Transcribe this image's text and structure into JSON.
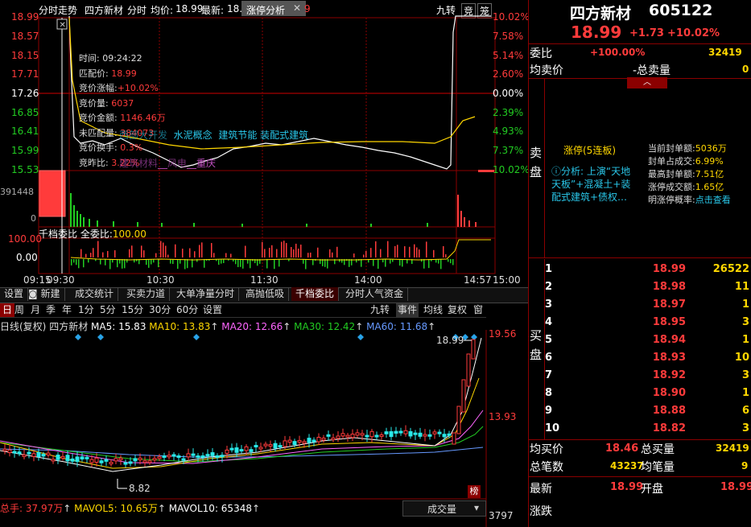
{
  "header": {
    "title": "分时走势",
    "stock": "四方新材",
    "mode": "分时",
    "avg_label": "均价:",
    "avg_value": "18.99",
    "latest_label": "最新:",
    "latest_value": "18.",
    "limit_tab": "涨停分析",
    "jiuzhuan": "九转",
    "jing": "竞",
    "long": "笼"
  },
  "intraday": {
    "price_ticks": [
      "18.99",
      "18.57",
      "18.15",
      "17.71",
      "17.26",
      "16.85",
      "16.41",
      "15.99",
      "15.53"
    ],
    "pct_ticks": [
      "10.02%",
      "7.58%",
      "5.14%",
      "2.60%",
      "0.00%",
      "2.39%",
      "4.93%",
      "7.37%",
      "10.02%"
    ],
    "vol_tick_high": "391448",
    "vol_tick_zero": "0",
    "time_labels": [
      "09:15",
      "09:30",
      "10:30",
      "11:30",
      "14:00",
      "14:57",
      "15:00"
    ],
    "tooltip": {
      "time_label": "时间:",
      "time": "09:24:22",
      "match_price_label": "匹配价:",
      "match_price": "18.99",
      "bid_change_label": "竞价涨幅:",
      "bid_change": "+10.02%",
      "bid_vol_label": "竞价量:",
      "bid_vol": "6037",
      "bid_amt_label": "竞价金额:",
      "bid_amt": "1146.46万",
      "unmatched_label": "未匹配量:",
      "unmatched": "384073",
      "turnover_label": "竞价换手:",
      "turnover": "0.3%",
      "ratio_label": "竞昨比:",
      "ratio": "3.22%"
    },
    "concepts": [
      "西部大开发",
      "水泥概念",
      "建筑节能",
      "装配式建筑"
    ],
    "concepts2": [
      "建筑材料",
      "风电",
      "重庆"
    ],
    "sub_title": "千档委比",
    "sub_label": "全委比:",
    "sub_value": "100.00",
    "sub_ticks": [
      "100.00",
      "0.00"
    ]
  },
  "tabs": [
    "设置",
    "新建",
    "成交统计",
    "买卖力道",
    "大单净量分时",
    "高抛低吸",
    "千档委比",
    "分时人气资金"
  ],
  "kline": {
    "periods": [
      "日",
      "周",
      "月",
      "季",
      "年",
      "1分",
      "5分",
      "15分",
      "30分",
      "60分",
      "设置"
    ],
    "right_tools": [
      "九转",
      "事件",
      "均线",
      "复权",
      "窗"
    ],
    "legend_prefix": "日线(复权)",
    "stock": "四方新材",
    "ma5": "MA5: 15.83",
    "ma10": "MA10: 13.83",
    "ma20": "MA20: 12.66",
    "ma30": "MA30: 12.42",
    "ma60": "MA60: 11.68",
    "right_ticks": [
      "19.56",
      "13.93"
    ],
    "high_mark": "18.99",
    "low_mark": "8.82",
    "vol_legend": "总手: 37.97万",
    "mavol5": "MAVOL5: 10.65万",
    "mavol10": "MAVOL10: 65348",
    "vol_select": "成交量",
    "vol_tick": "3797",
    "bang": "榜"
  },
  "quote": {
    "name": "四方新材",
    "code": "605122",
    "price": "18.99",
    "change": "+1.73",
    "pct": "+10.02%",
    "weibi_label": "委比",
    "weibi_val": "+100.00%",
    "weibi_num": "32419",
    "junmaijia_label": "均卖价",
    "total_sell_label": "-总卖量",
    "total_sell_val": "0",
    "sell_label": "卖盘",
    "limit_title": "涨停(5连板)",
    "analysis": "ⓘ分析: 上演“天地天板”+混凝土+装配式建筑+债权…",
    "stats": [
      {
        "label": "当前封单额:",
        "value": "5036万"
      },
      {
        "label": "封单占成交:",
        "value": "6.99%"
      },
      {
        "label": "最高封单额:",
        "value": "7.51亿"
      },
      {
        "label": "涨停成交额:",
        "value": "1.65亿"
      },
      {
        "label": "明涨停概率:",
        "value": "点击查看"
      }
    ],
    "buy_label": "买盘",
    "book": [
      {
        "lvl": "1",
        "px": "18.99",
        "vol": "26522"
      },
      {
        "lvl": "2",
        "px": "18.98",
        "vol": "11"
      },
      {
        "lvl": "3",
        "px": "18.97",
        "vol": "1"
      },
      {
        "lvl": "4",
        "px": "18.95",
        "vol": "3"
      },
      {
        "lvl": "5",
        "px": "18.94",
        "vol": "1"
      },
      {
        "lvl": "6",
        "px": "18.93",
        "vol": "10"
      },
      {
        "lvl": "7",
        "px": "18.92",
        "vol": "3"
      },
      {
        "lvl": "8",
        "px": "18.90",
        "vol": "1"
      },
      {
        "lvl": "9",
        "px": "18.88",
        "vol": "6"
      },
      {
        "lvl": "10",
        "px": "18.82",
        "vol": "3"
      }
    ],
    "avg_buy_label": "均买价",
    "avg_buy": "18.46",
    "total_buy_label": "总买量",
    "total_buy": "32419",
    "total_trades_label": "总笔数",
    "total_trades": "43237",
    "avg_lot_label": "均笔量",
    "avg_lot": "9",
    "latest_label": "最新",
    "latest": "18.99",
    "open_label": "开盘",
    "open": "18.99",
    "change_label": "涨跌"
  },
  "colors": {
    "up": "#ff3b3b",
    "down": "#22cc22",
    "bg": "#000000",
    "grid": "#8b0000",
    "avg_line": "#ffd700"
  }
}
